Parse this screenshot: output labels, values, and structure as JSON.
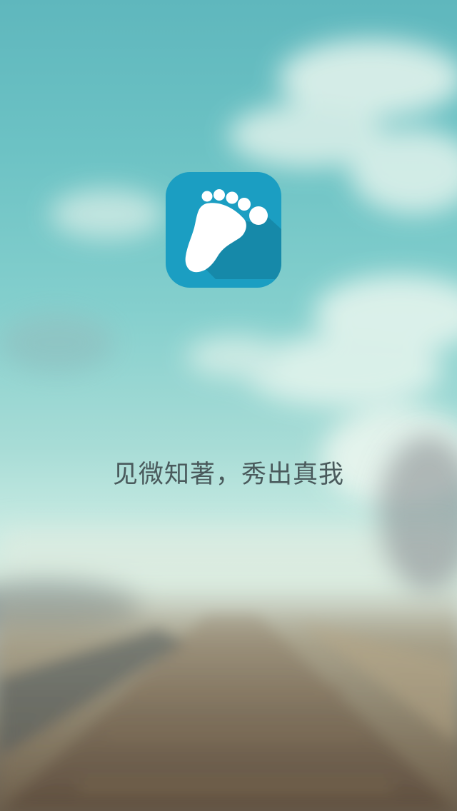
{
  "splash": {
    "slogan": "见微知著，秀出真我"
  },
  "app_icon": {
    "icon_name": "footprint-icon",
    "background_color": "#1b9ec2",
    "shadow_color": "#1686a6",
    "foot_color": "#ffffff"
  },
  "background": {
    "description_colors": {
      "sky": "#6cc2c4",
      "cloud": "#e8f5ee",
      "ground": "#7a7464"
    }
  }
}
